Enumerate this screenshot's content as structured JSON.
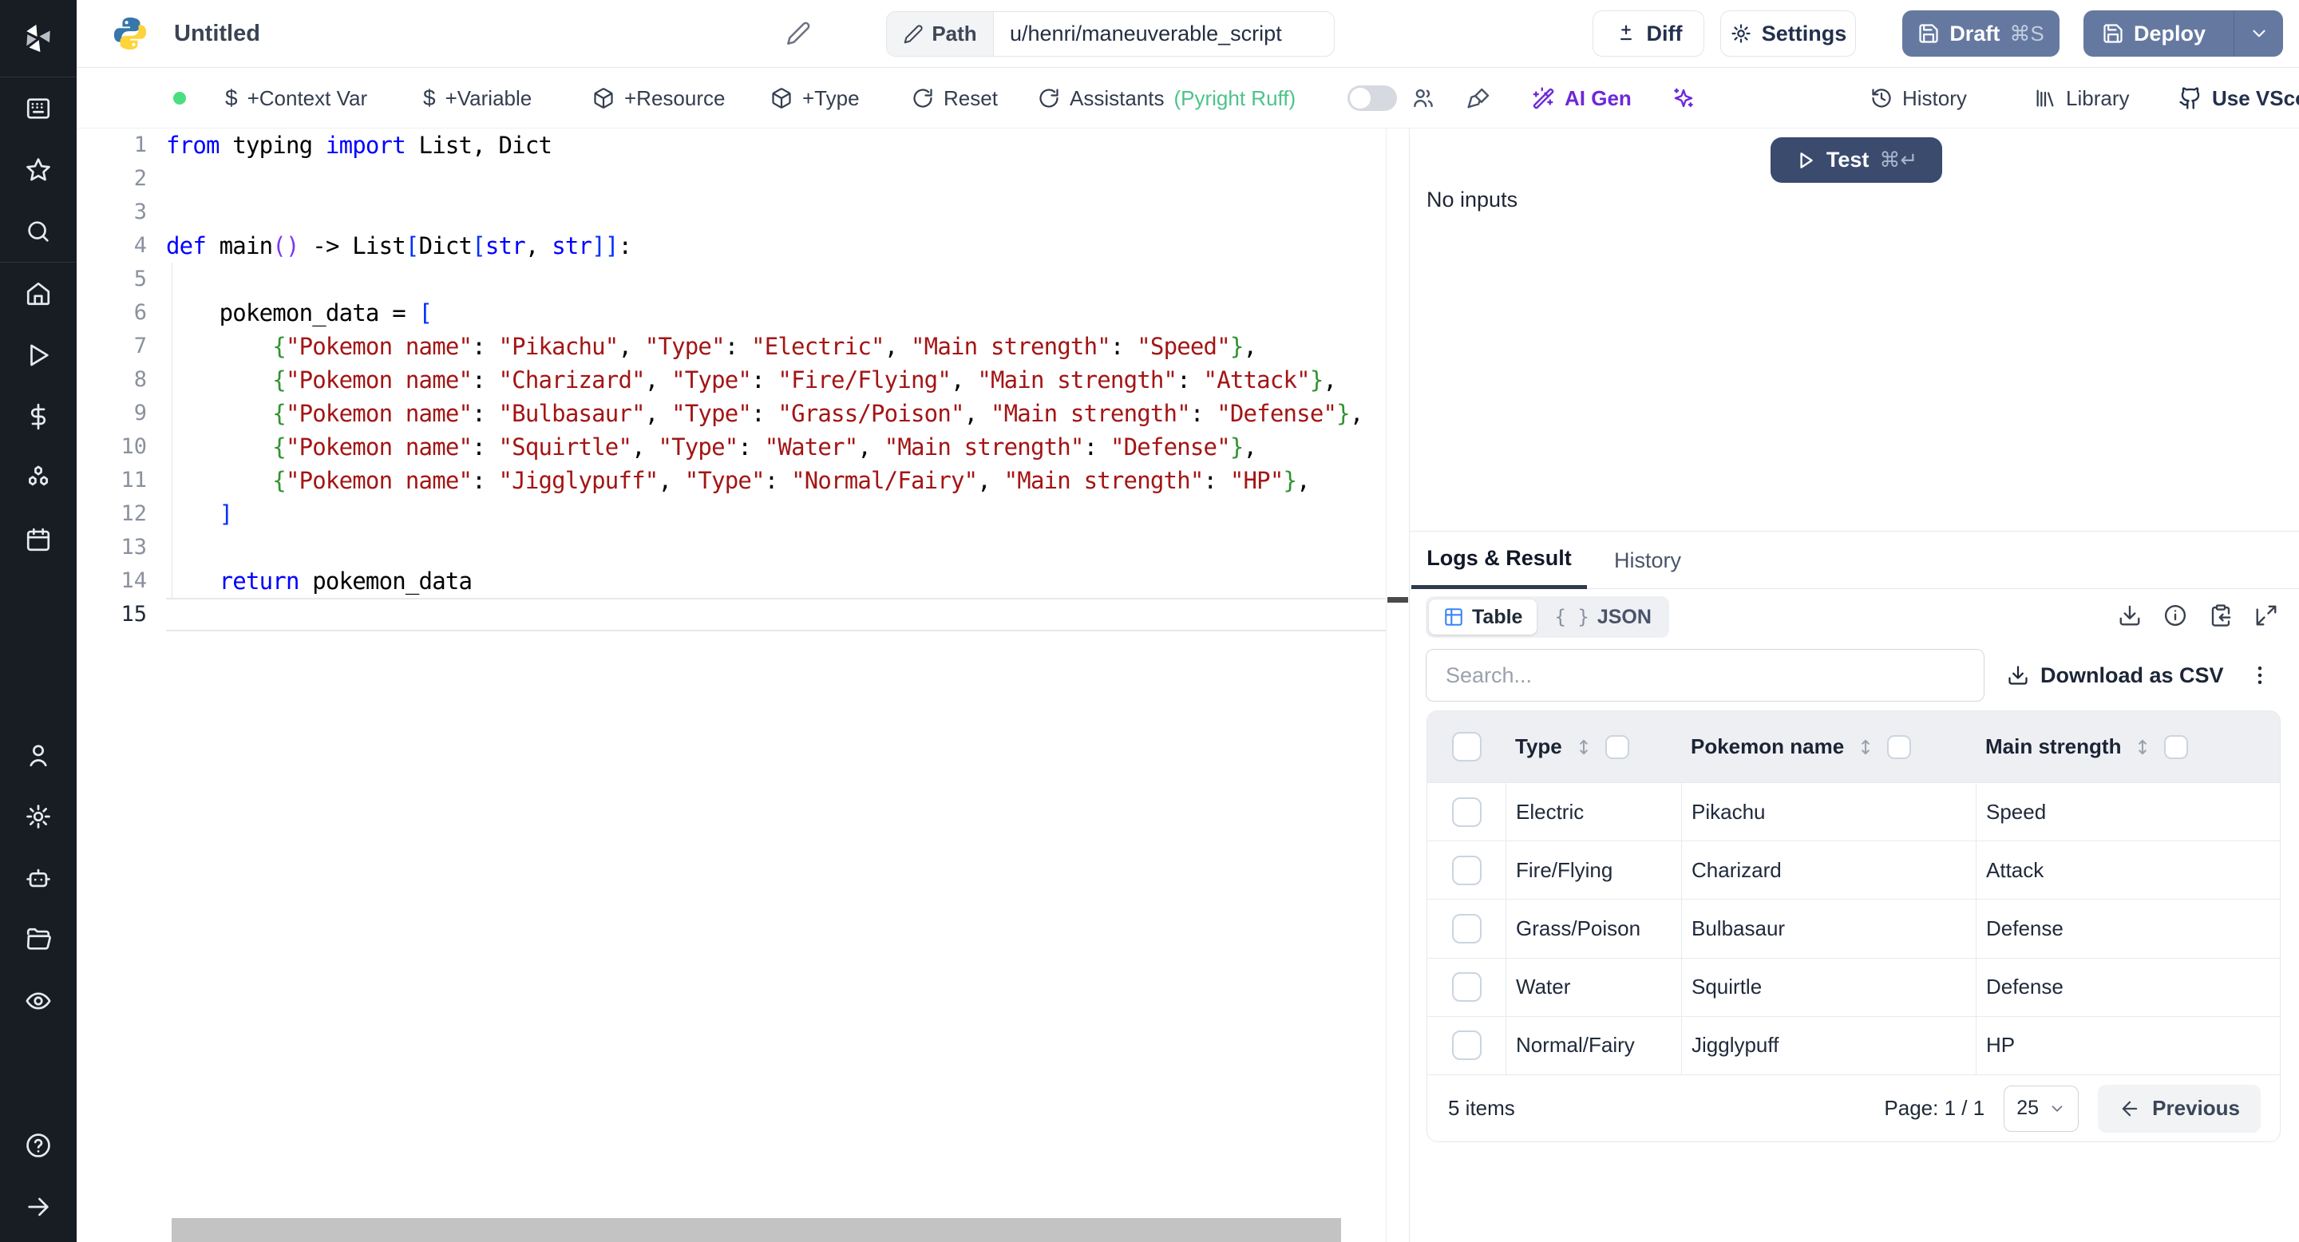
{
  "topbar": {
    "title": "Untitled",
    "path_label": "Path",
    "path_value": "u/henri/maneuverable_script",
    "diff_label": "Diff",
    "settings_label": "Settings",
    "draft_label": "Draft",
    "draft_shortcut": "⌘S",
    "deploy_label": "Deploy"
  },
  "toolbar": {
    "context_var": "+Context Var",
    "variable": "+Variable",
    "resource": "+Resource",
    "type": "+Type",
    "reset": "Reset",
    "assistants": "Assistants",
    "assistants_lint": "(Pyright Ruff)",
    "ai_gen": "AI Gen",
    "history": "History",
    "library": "Library",
    "vscode": "Use VScode",
    "dollar_glyph": "$"
  },
  "editor": {
    "active_line": 15,
    "lines": [
      [
        [
          "k",
          "from"
        ],
        [
          "p",
          " typing "
        ],
        [
          "k",
          "import"
        ],
        [
          "p",
          " List, Dict"
        ]
      ],
      [],
      [],
      [
        [
          "k",
          "def"
        ],
        [
          "p",
          " main"
        ],
        [
          "pp",
          "()"
        ],
        [
          "p",
          " -> List"
        ],
        [
          "bb",
          "["
        ],
        [
          "p",
          "Dict"
        ],
        [
          "bb",
          "["
        ],
        [
          "k",
          "str"
        ],
        [
          "p",
          ", "
        ],
        [
          "k",
          "str"
        ],
        [
          "bb",
          "]]"
        ],
        [
          "p",
          ":"
        ]
      ],
      [],
      [
        [
          "p",
          "    pokemon_data = "
        ],
        [
          "bb",
          "["
        ]
      ],
      [
        [
          "p",
          "        "
        ],
        [
          "gb",
          "{"
        ],
        [
          "s",
          "\"Pokemon name\""
        ],
        [
          "p",
          ": "
        ],
        [
          "s",
          "\"Pikachu\""
        ],
        [
          "p",
          ", "
        ],
        [
          "s",
          "\"Type\""
        ],
        [
          "p",
          ": "
        ],
        [
          "s",
          "\"Electric\""
        ],
        [
          "p",
          ", "
        ],
        [
          "s",
          "\"Main strength\""
        ],
        [
          "p",
          ": "
        ],
        [
          "s",
          "\"Speed\""
        ],
        [
          "gb",
          "}"
        ],
        [
          "p",
          ","
        ]
      ],
      [
        [
          "p",
          "        "
        ],
        [
          "gb",
          "{"
        ],
        [
          "s",
          "\"Pokemon name\""
        ],
        [
          "p",
          ": "
        ],
        [
          "s",
          "\"Charizard\""
        ],
        [
          "p",
          ", "
        ],
        [
          "s",
          "\"Type\""
        ],
        [
          "p",
          ": "
        ],
        [
          "s",
          "\"Fire/Flying\""
        ],
        [
          "p",
          ", "
        ],
        [
          "s",
          "\"Main strength\""
        ],
        [
          "p",
          ": "
        ],
        [
          "s",
          "\"Attack\""
        ],
        [
          "gb",
          "}"
        ],
        [
          "p",
          ","
        ]
      ],
      [
        [
          "p",
          "        "
        ],
        [
          "gb",
          "{"
        ],
        [
          "s",
          "\"Pokemon name\""
        ],
        [
          "p",
          ": "
        ],
        [
          "s",
          "\"Bulbasaur\""
        ],
        [
          "p",
          ", "
        ],
        [
          "s",
          "\"Type\""
        ],
        [
          "p",
          ": "
        ],
        [
          "s",
          "\"Grass/Poison\""
        ],
        [
          "p",
          ", "
        ],
        [
          "s",
          "\"Main strength\""
        ],
        [
          "p",
          ": "
        ],
        [
          "s",
          "\"Defense\""
        ],
        [
          "gb",
          "}"
        ],
        [
          "p",
          ","
        ]
      ],
      [
        [
          "p",
          "        "
        ],
        [
          "gb",
          "{"
        ],
        [
          "s",
          "\"Pokemon name\""
        ],
        [
          "p",
          ": "
        ],
        [
          "s",
          "\"Squirtle\""
        ],
        [
          "p",
          ", "
        ],
        [
          "s",
          "\"Type\""
        ],
        [
          "p",
          ": "
        ],
        [
          "s",
          "\"Water\""
        ],
        [
          "p",
          ", "
        ],
        [
          "s",
          "\"Main strength\""
        ],
        [
          "p",
          ": "
        ],
        [
          "s",
          "\"Defense\""
        ],
        [
          "gb",
          "}"
        ],
        [
          "p",
          ","
        ]
      ],
      [
        [
          "p",
          "        "
        ],
        [
          "gb",
          "{"
        ],
        [
          "s",
          "\"Pokemon name\""
        ],
        [
          "p",
          ": "
        ],
        [
          "s",
          "\"Jigglypuff\""
        ],
        [
          "p",
          ", "
        ],
        [
          "s",
          "\"Type\""
        ],
        [
          "p",
          ": "
        ],
        [
          "s",
          "\"Normal/Fairy\""
        ],
        [
          "p",
          ", "
        ],
        [
          "s",
          "\"Main strength\""
        ],
        [
          "p",
          ": "
        ],
        [
          "s",
          "\"HP\""
        ],
        [
          "gb",
          "}"
        ],
        [
          "p",
          ","
        ]
      ],
      [
        [
          "p",
          "    "
        ],
        [
          "bb",
          "]"
        ]
      ],
      [],
      [
        [
          "p",
          "    "
        ],
        [
          "k",
          "return"
        ],
        [
          "p",
          " pokemon_data"
        ]
      ],
      []
    ]
  },
  "run": {
    "test_label": "Test",
    "test_shortcut": "⌘↵",
    "no_inputs": "No inputs"
  },
  "result_panel": {
    "tabs": {
      "logs": "Logs & Result",
      "history": "History"
    },
    "view_modes": {
      "table": "Table",
      "json": "JSON",
      "braces_glyph": "{ }"
    },
    "search_placeholder": "Search...",
    "download_csv_label": "Download as CSV",
    "kebab_glyph": "⋮",
    "pagination": {
      "items_label": "5 items",
      "page_label": "Page: 1 / 1",
      "page_size": "25",
      "previous_label": "Previous"
    }
  },
  "table": {
    "columns": [
      "Type",
      "Pokemon name",
      "Main strength"
    ],
    "rows": [
      [
        "Electric",
        "Pikachu",
        "Speed"
      ],
      [
        "Fire/Flying",
        "Charizard",
        "Attack"
      ],
      [
        "Grass/Poison",
        "Bulbasaur",
        "Defense"
      ],
      [
        "Water",
        "Squirtle",
        "Defense"
      ],
      [
        "Normal/Fairy",
        "Jigglypuff",
        "HP"
      ]
    ]
  },
  "icons": {
    "sidebar": [
      "windmill-logo",
      "workspace-icon",
      "favorites-star-icon",
      "search-icon",
      "home-icon",
      "runs-play-icon",
      "variables-dollar-icon",
      "resources-boxes-icon",
      "schedules-calendar-icon",
      "user-icon",
      "settings-gear-icon",
      "workers-robot-icon",
      "folders-icon",
      "audit-eye-icon",
      "help-icon",
      "expand-arrow-icon"
    ],
    "topbar": [
      "python-logo",
      "pencil-icon",
      "diff-plus-minus-icon",
      "settings-gear-icon",
      "save-icon",
      "chevron-down-icon"
    ],
    "toolbar": [
      "status-dot",
      "dollar-icon",
      "package-icon",
      "reset-icon",
      "assistants-refresh-icon",
      "toggle-switch",
      "collaborators-icon",
      "format-brush-icon",
      "ai-wand-icon",
      "sparkles-icon",
      "history-clock-icon",
      "library-icon",
      "github-cat-icon"
    ],
    "result": [
      "play-icon",
      "table-grid-icon",
      "braces-icon",
      "download-icon",
      "info-icon",
      "clipboard-copy-icon",
      "expand-icon",
      "sort-icon",
      "checkbox",
      "arrow-left-icon",
      "chevron-down-icon",
      "kebab-icon"
    ]
  },
  "colors": {
    "sidebar_bg": "#181c23",
    "slate_button": "#6579a0",
    "test_button": "#3a4b6e",
    "ai_purple": "#6d28d9",
    "status_green": "#4ade80",
    "lint_green": "#4cc38a",
    "code_keyword": "#0000ff",
    "code_string": "#a31515",
    "bracket_square": "#0431fa",
    "bracket_curly": "#319331",
    "bracket_paren": "#7c3aed",
    "table_icon_blue": "#3b82f6"
  }
}
